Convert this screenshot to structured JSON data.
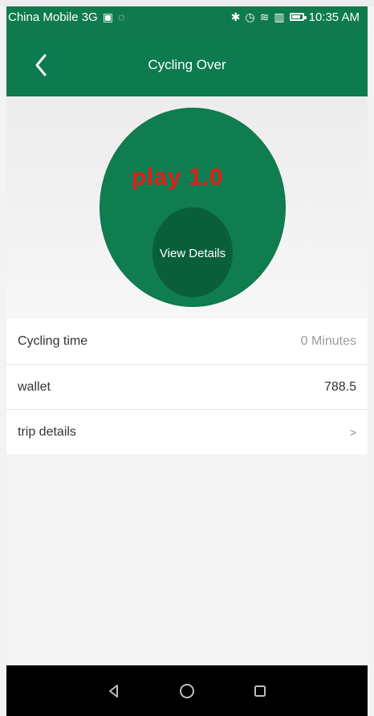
{
  "statusbar": {
    "carrier": "China Mobile 3G",
    "time": "10:35 AM",
    "icons": [
      "sim-icon",
      "notification-icon",
      "bluetooth-icon",
      "alarm-icon",
      "wifi-icon",
      "signal-icon",
      "battery-icon"
    ]
  },
  "header": {
    "title": "Cycling Over"
  },
  "hero": {
    "title": "play 1.0",
    "button_label": "View Details",
    "colors": {
      "circle": "#0f7d4f",
      "inner_circle": "#0a5f3b",
      "title": "#e21a1a"
    }
  },
  "details": {
    "rows": [
      {
        "label": "Cycling time",
        "value": "0 Minutes"
      },
      {
        "label": "wallet",
        "value": "788.5"
      },
      {
        "label": "trip details",
        "value": ">"
      }
    ]
  },
  "theme": {
    "primary": "#0d7b4f",
    "background": "#f4f4f4",
    "navbar": "#000000"
  }
}
